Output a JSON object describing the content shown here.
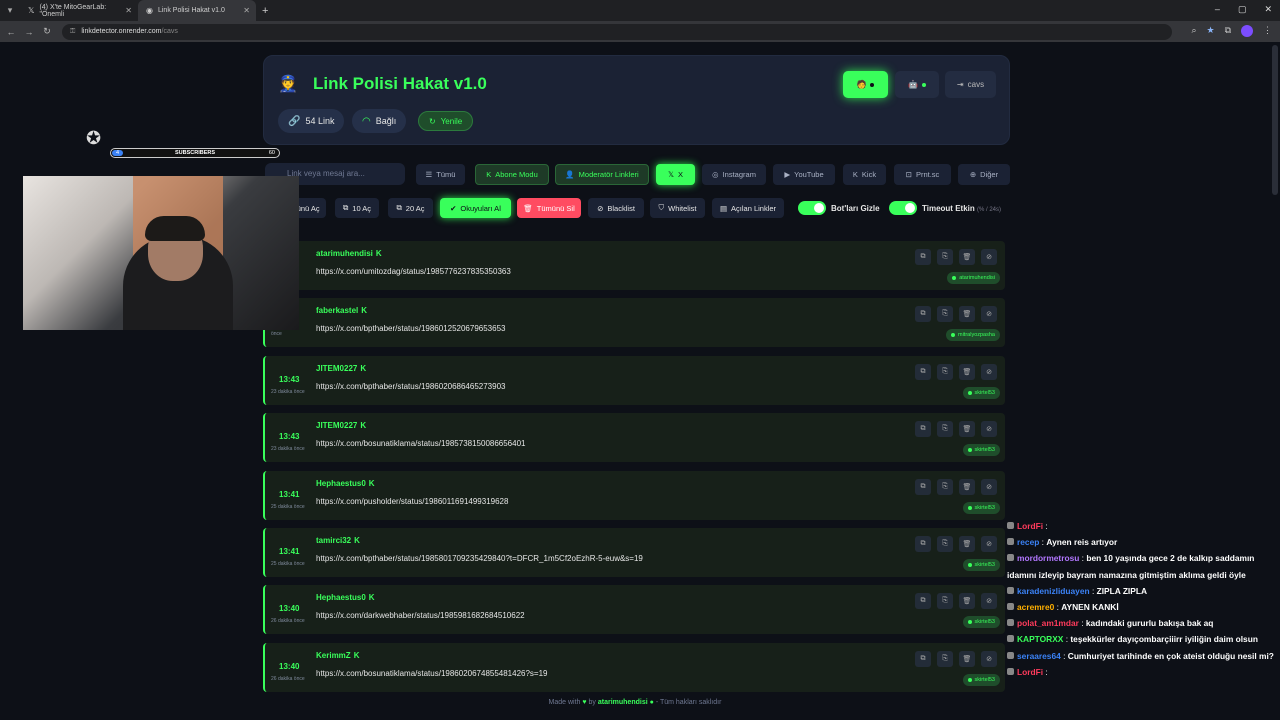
{
  "browser": {
    "tabs": [
      {
        "title": "(4) X'te MitoGearLab: \"Önemli",
        "icon": "x-icon"
      },
      {
        "title": "Link Polisi Hakat v1.0",
        "icon": "page-icon",
        "active": true
      }
    ],
    "url_host": "linkdetector.onrender.com",
    "url_path": "/cavs"
  },
  "header": {
    "title": "Link Polisi Hakat v1.0",
    "link_count": "54 Link",
    "status": "Bağlı",
    "refresh": "Yenile",
    "user": "cavs"
  },
  "filters": {
    "search_placeholder": "Link veya mesaj ara...",
    "buttons": [
      "Tümü",
      "Abone Modu",
      "Moderatör Linkleri",
      "X",
      "Instagram",
      "YouTube",
      "Kick",
      "Prnt.sc",
      "Diğer"
    ]
  },
  "actions": {
    "buttons": [
      "Tümünü Aç",
      "10 Aç",
      "20 Aç",
      "Okuyuları Al",
      "Tümünü Sil",
      "Blacklist",
      "Whitelist",
      "Açılan Linkler"
    ],
    "toggle_bots": "Bot'ları Gizle",
    "toggle_timeout": "Timeout Etkin",
    "timeout_sub": "(% / 24s)"
  },
  "links": [
    {
      "time": "",
      "ago": "önce",
      "user": "atarimuhendisi",
      "url": "https://x.com/umitozdag/status/1985776237835350363",
      "badge": "atarimuhendisi"
    },
    {
      "time": "",
      "ago": "önce",
      "user": "faberkastel",
      "url": "https://x.com/bpthaber/status/1986012520679653653",
      "badge": "mitralyozpasha"
    },
    {
      "time": "13:43",
      "ago": "23 dakika önce",
      "user": "JITEM0227",
      "url": "https://x.com/bpthaber/status/1986020686465273903",
      "badge": "skirtel53"
    },
    {
      "time": "13:43",
      "ago": "23 dakika önce",
      "user": "JITEM0227",
      "url": "https://x.com/bosunatiklama/status/1985738150086656401",
      "badge": "skirtel53"
    },
    {
      "time": "13:41",
      "ago": "25 dakika önce",
      "user": "Hephaestus0",
      "url": "https://x.com/pusholder/status/1986011691499319628",
      "badge": "skirtel53"
    },
    {
      "time": "13:41",
      "ago": "25 dakika önce",
      "user": "tamirci32",
      "url": "https://x.com/bpthaber/status/1985801709235429840?t=DFCR_1m5Cf2oEzhR-5-euw&s=19",
      "badge": "skirtel53"
    },
    {
      "time": "13:40",
      "ago": "26 dakika önce",
      "user": "Hephaestus0",
      "url": "https://x.com/darkwebhaber/status/1985981682684510622",
      "badge": "skirtel53"
    },
    {
      "time": "13:40",
      "ago": "26 dakika önce",
      "user": "KerimmZ",
      "url": "https://x.com/bosunatiklama/status/1986020674855481426?s=19",
      "badge": "skirtel53"
    }
  ],
  "footer": {
    "made_with": "Made with",
    "by": "by",
    "author": "atarimuhendisi",
    "rights": "- Tüm hakları saklıdır"
  },
  "overlay": {
    "subscribers_label": "SUBSCRIBERS",
    "subscribers_current": "4",
    "subscribers_goal": "60",
    "chat": [
      {
        "name": "LordFi",
        "color": "#ff3b5c",
        "text": ""
      },
      {
        "name": "recep",
        "color": "#3b82f6",
        "text": "Aynen reis artıyor"
      },
      {
        "name": "mordormetrosu",
        "color": "#b277ff",
        "text": "ben 10 yaşında gece 2 de kalkıp saddamın idamını izleyip bayram namazına gitmiştim aklıma geldi öyle"
      },
      {
        "name": "karadenizliduayen",
        "color": "#3b82f6",
        "text": "ZIPLA ZIPLA"
      },
      {
        "name": "acremre0",
        "color": "#ffb000",
        "text": "AYNEN KANKİ"
      },
      {
        "name": "polat_am1mdar",
        "color": "#ff3b5c",
        "text": "kadındaki gururlu bakışa bak aq"
      },
      {
        "name": "KAPTORXX",
        "color": "#39ff5b",
        "text": "teşekkürler dayıçombarçiiirr iyiliğin daim olsun"
      },
      {
        "name": "seraares64",
        "color": "#3b82f6",
        "text": "Cumhuriyet tarihinde en çok ateist olduğu nesil mi?"
      },
      {
        "name": "LordFi",
        "color": "#ff3b5c",
        "text": ""
      }
    ]
  }
}
